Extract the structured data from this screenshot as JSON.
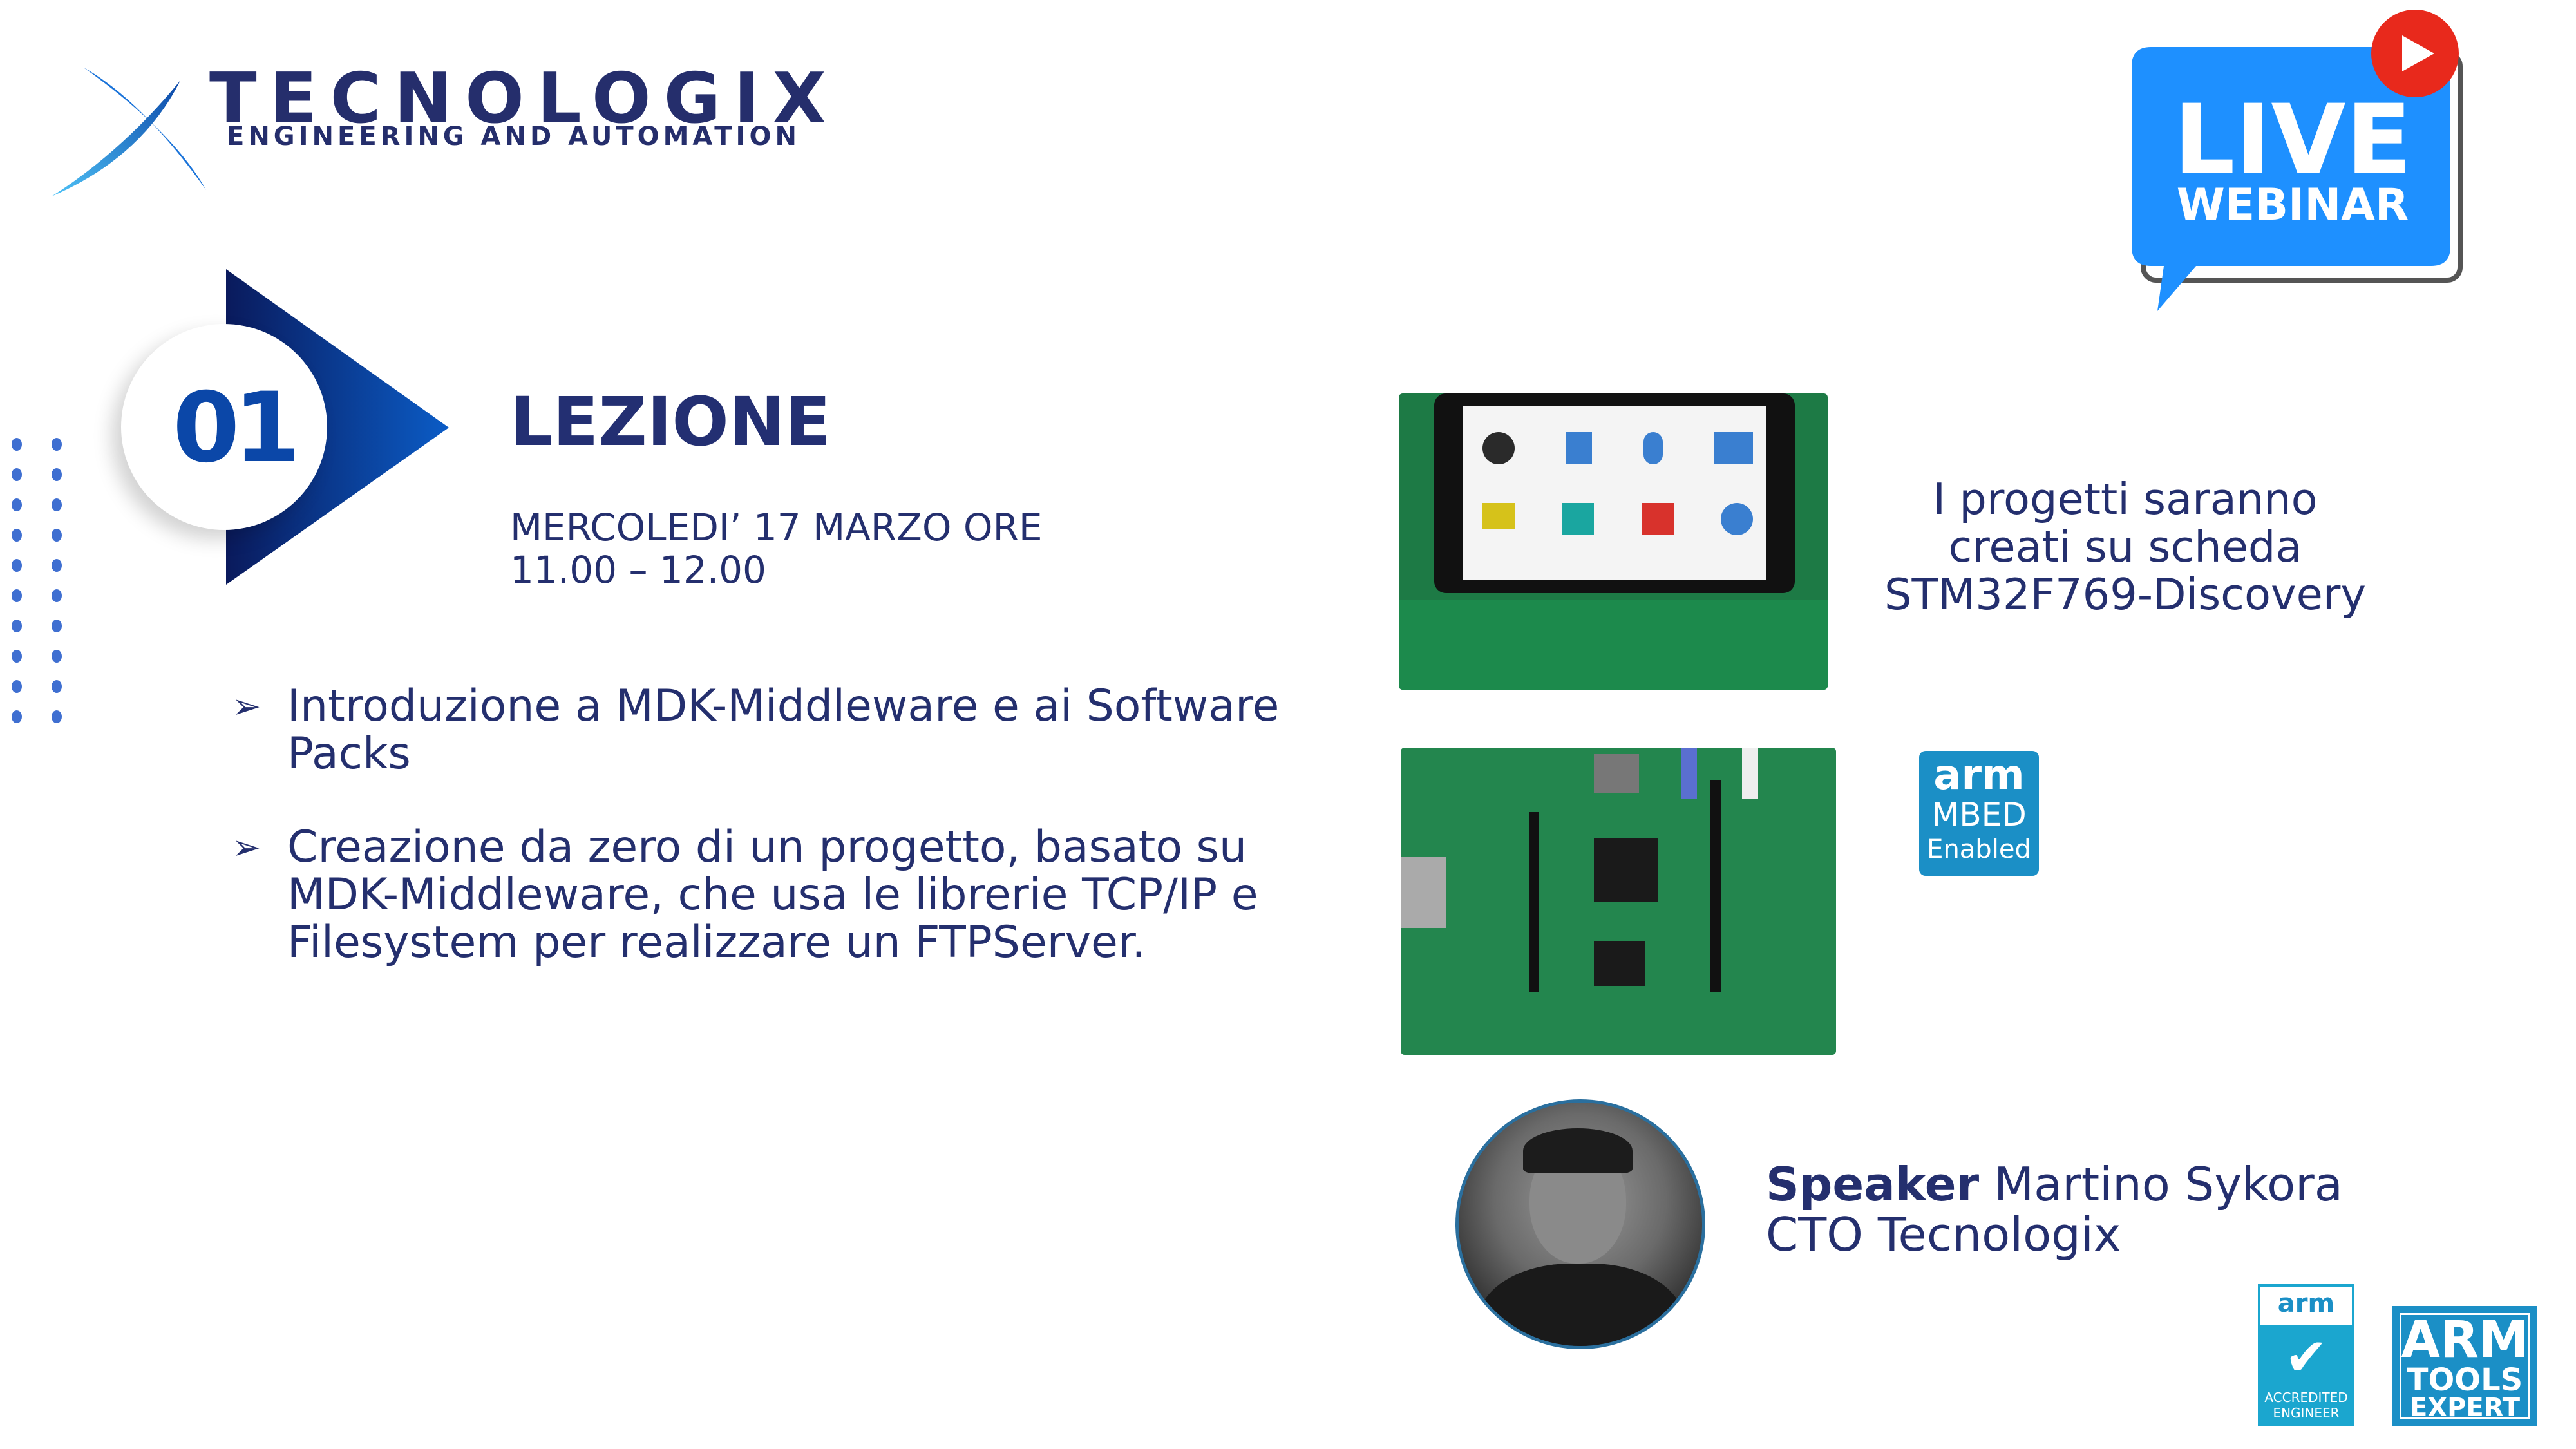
{
  "logo": {
    "name": "TECNOLOGIX",
    "tagline": "ENGINEERING AND AUTOMATION"
  },
  "badge": {
    "line1": "LIVE",
    "line2": "WEBINAR",
    "accent": "#1e90ff",
    "play_color": "#e8291c"
  },
  "lesson": {
    "number": "01",
    "title": "LEZIONE",
    "date_line1": "MERCOLEDI’ 17 MARZO ORE",
    "date_line2": "11.00 – 12.00"
  },
  "bullets": [
    {
      "icon": "arrow-bullet-icon",
      "text": "Introduzione a MDK-Middleware e ai Software Packs"
    },
    {
      "icon": "arrow-bullet-icon",
      "text": "Creazione da zero di un progetto, basato su MDK-Middleware, che usa le librerie TCP/IP e Filesystem per realizzare un FTPServer."
    }
  ],
  "board_info": {
    "line1": "I progetti saranno",
    "line2": "creati su scheda",
    "line3": "STM32F769-Discovery"
  },
  "mbed_badge": {
    "line1": "arm",
    "line2": "MBED",
    "line3": "Enabled"
  },
  "speaker": {
    "label": "Speaker",
    "name": "Martino Sykora",
    "role": "CTO Tecnologix"
  },
  "certs": {
    "accredited": {
      "line1": "arm",
      "line2": "ACCREDITED",
      "line3": "ENGINEER"
    },
    "tools_expert": {
      "line1": "ARM",
      "line2": "TOOLS",
      "line3": "EXPERT"
    }
  },
  "colors": {
    "navy": "#242f6e",
    "blue": "#0b47a8",
    "dots": "#3f6fd1",
    "arm_blue": "#1b8fc6"
  }
}
